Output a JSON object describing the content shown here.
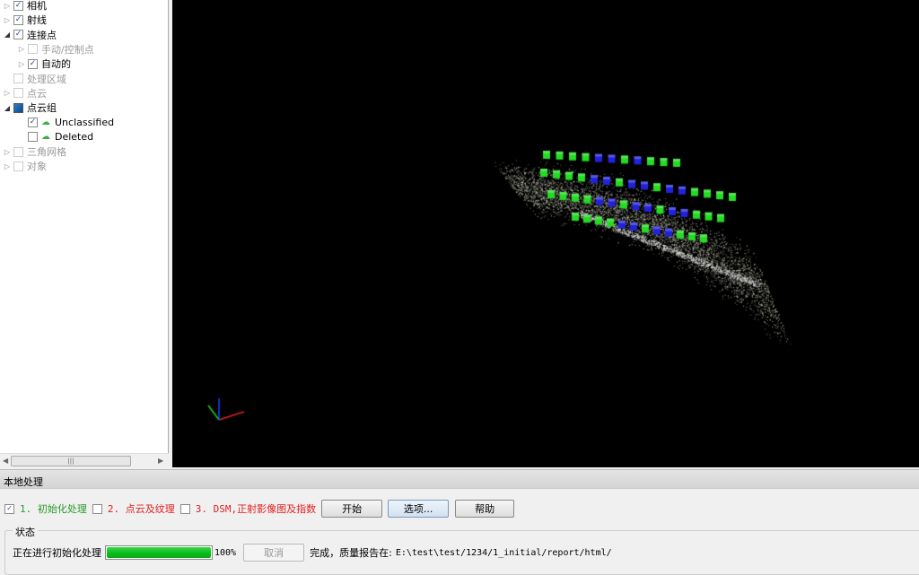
{
  "tree": [
    {
      "label": "相机",
      "expander": "right",
      "check": "checked",
      "indent": 0
    },
    {
      "label": "射线",
      "expander": "right",
      "check": "checked",
      "indent": 0
    },
    {
      "label": "连接点",
      "expander": "down",
      "check": "checked",
      "indent": 0
    },
    {
      "label": "手动/控制点",
      "expander": "right",
      "check": "disabled",
      "indent": 1
    },
    {
      "label": "自动的",
      "expander": "right",
      "check": "checked",
      "indent": 1
    },
    {
      "label": "处理区域",
      "expander": "none",
      "check": "disabled",
      "indent": 0
    },
    {
      "label": "点云",
      "expander": "right",
      "check": "disabled",
      "indent": 0
    },
    {
      "label": "点云组",
      "expander": "down",
      "check": "partial",
      "indent": 0
    },
    {
      "label": "Unclassified",
      "expander": "none",
      "check": "checked",
      "indent": 1,
      "icon": "cloud-icon"
    },
    {
      "label": "Deleted",
      "expander": "none",
      "check": "unchecked",
      "indent": 1,
      "icon": "cloud-icon"
    },
    {
      "label": "三角网格",
      "expander": "right",
      "check": "disabled",
      "indent": 0
    },
    {
      "label": "对象",
      "expander": "right",
      "check": "disabled",
      "indent": 0
    }
  ],
  "panel": {
    "title": "本地处理",
    "steps": [
      {
        "label": "1. 初始化处理",
        "checked": true,
        "color": "#2a9a2a"
      },
      {
        "label": "2. 点云及纹理",
        "checked": false,
        "color": "#e02020"
      },
      {
        "label": "3. DSM,正射影像图及指数",
        "checked": false,
        "color": "#e02020"
      }
    ],
    "start_label": "开始",
    "options_label": "选项...",
    "help_label": "帮助",
    "status_group": "状态",
    "status_text": "正在进行初始化处理",
    "progress_percent": 100,
    "progress_label": "100%",
    "cancel_label": "取消",
    "result_prefix": "完成，质量报告在:",
    "result_path": "E:\\test\\test/1234/1_initial/report/html/"
  },
  "viewer": {
    "background": "#000000",
    "camera_colors": [
      "#22dd22",
      "#2222dd"
    ],
    "axis_colors": [
      "#dd2222",
      "#22cc22",
      "#2244ff"
    ]
  }
}
